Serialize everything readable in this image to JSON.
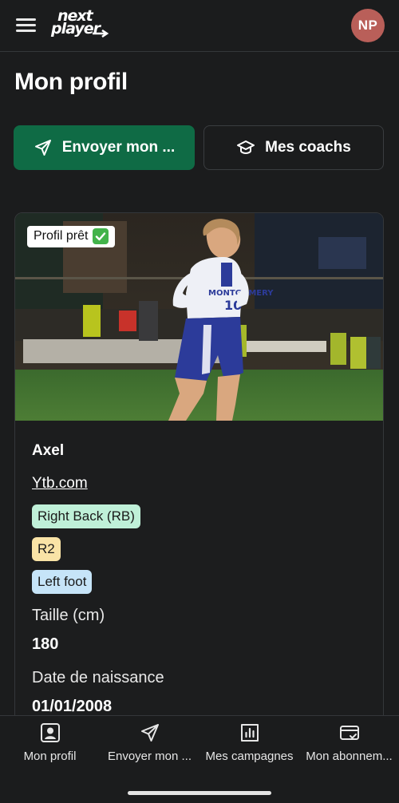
{
  "header": {
    "logo_line1": "next",
    "logo_line2": "player",
    "avatar_initials": "NP"
  },
  "page": {
    "title": "Mon profil"
  },
  "actions": {
    "send_label": "Envoyer mon ...",
    "coaches_label": "Mes coachs"
  },
  "profile": {
    "ready_badge": "Profil prêt",
    "name": "Axel",
    "link": "Ytb.com",
    "position_tag": "Right Back (RB)",
    "level_tag": "R2",
    "foot_tag": "Left foot",
    "height_label": "Taille (cm)",
    "height_value": "180",
    "dob_label": "Date de naissance",
    "dob_value": "01/01/2008",
    "jersey_text": "MONTGOMERY",
    "jersey_number": "10"
  },
  "bottom_nav": {
    "items": [
      {
        "label": "Mon profil",
        "icon": "profile-icon"
      },
      {
        "label": "Envoyer mon ...",
        "icon": "send-icon"
      },
      {
        "label": "Mes campagnes",
        "icon": "chart-icon"
      },
      {
        "label": "Mon abonnem...",
        "icon": "card-icon"
      }
    ]
  },
  "colors": {
    "background": "#1b1c1d",
    "primary": "#0f6b45",
    "avatar": "#b95f59",
    "tag_position": "#bff0d8",
    "tag_level": "#f9e3a6",
    "tag_foot": "#c6e4f8"
  }
}
